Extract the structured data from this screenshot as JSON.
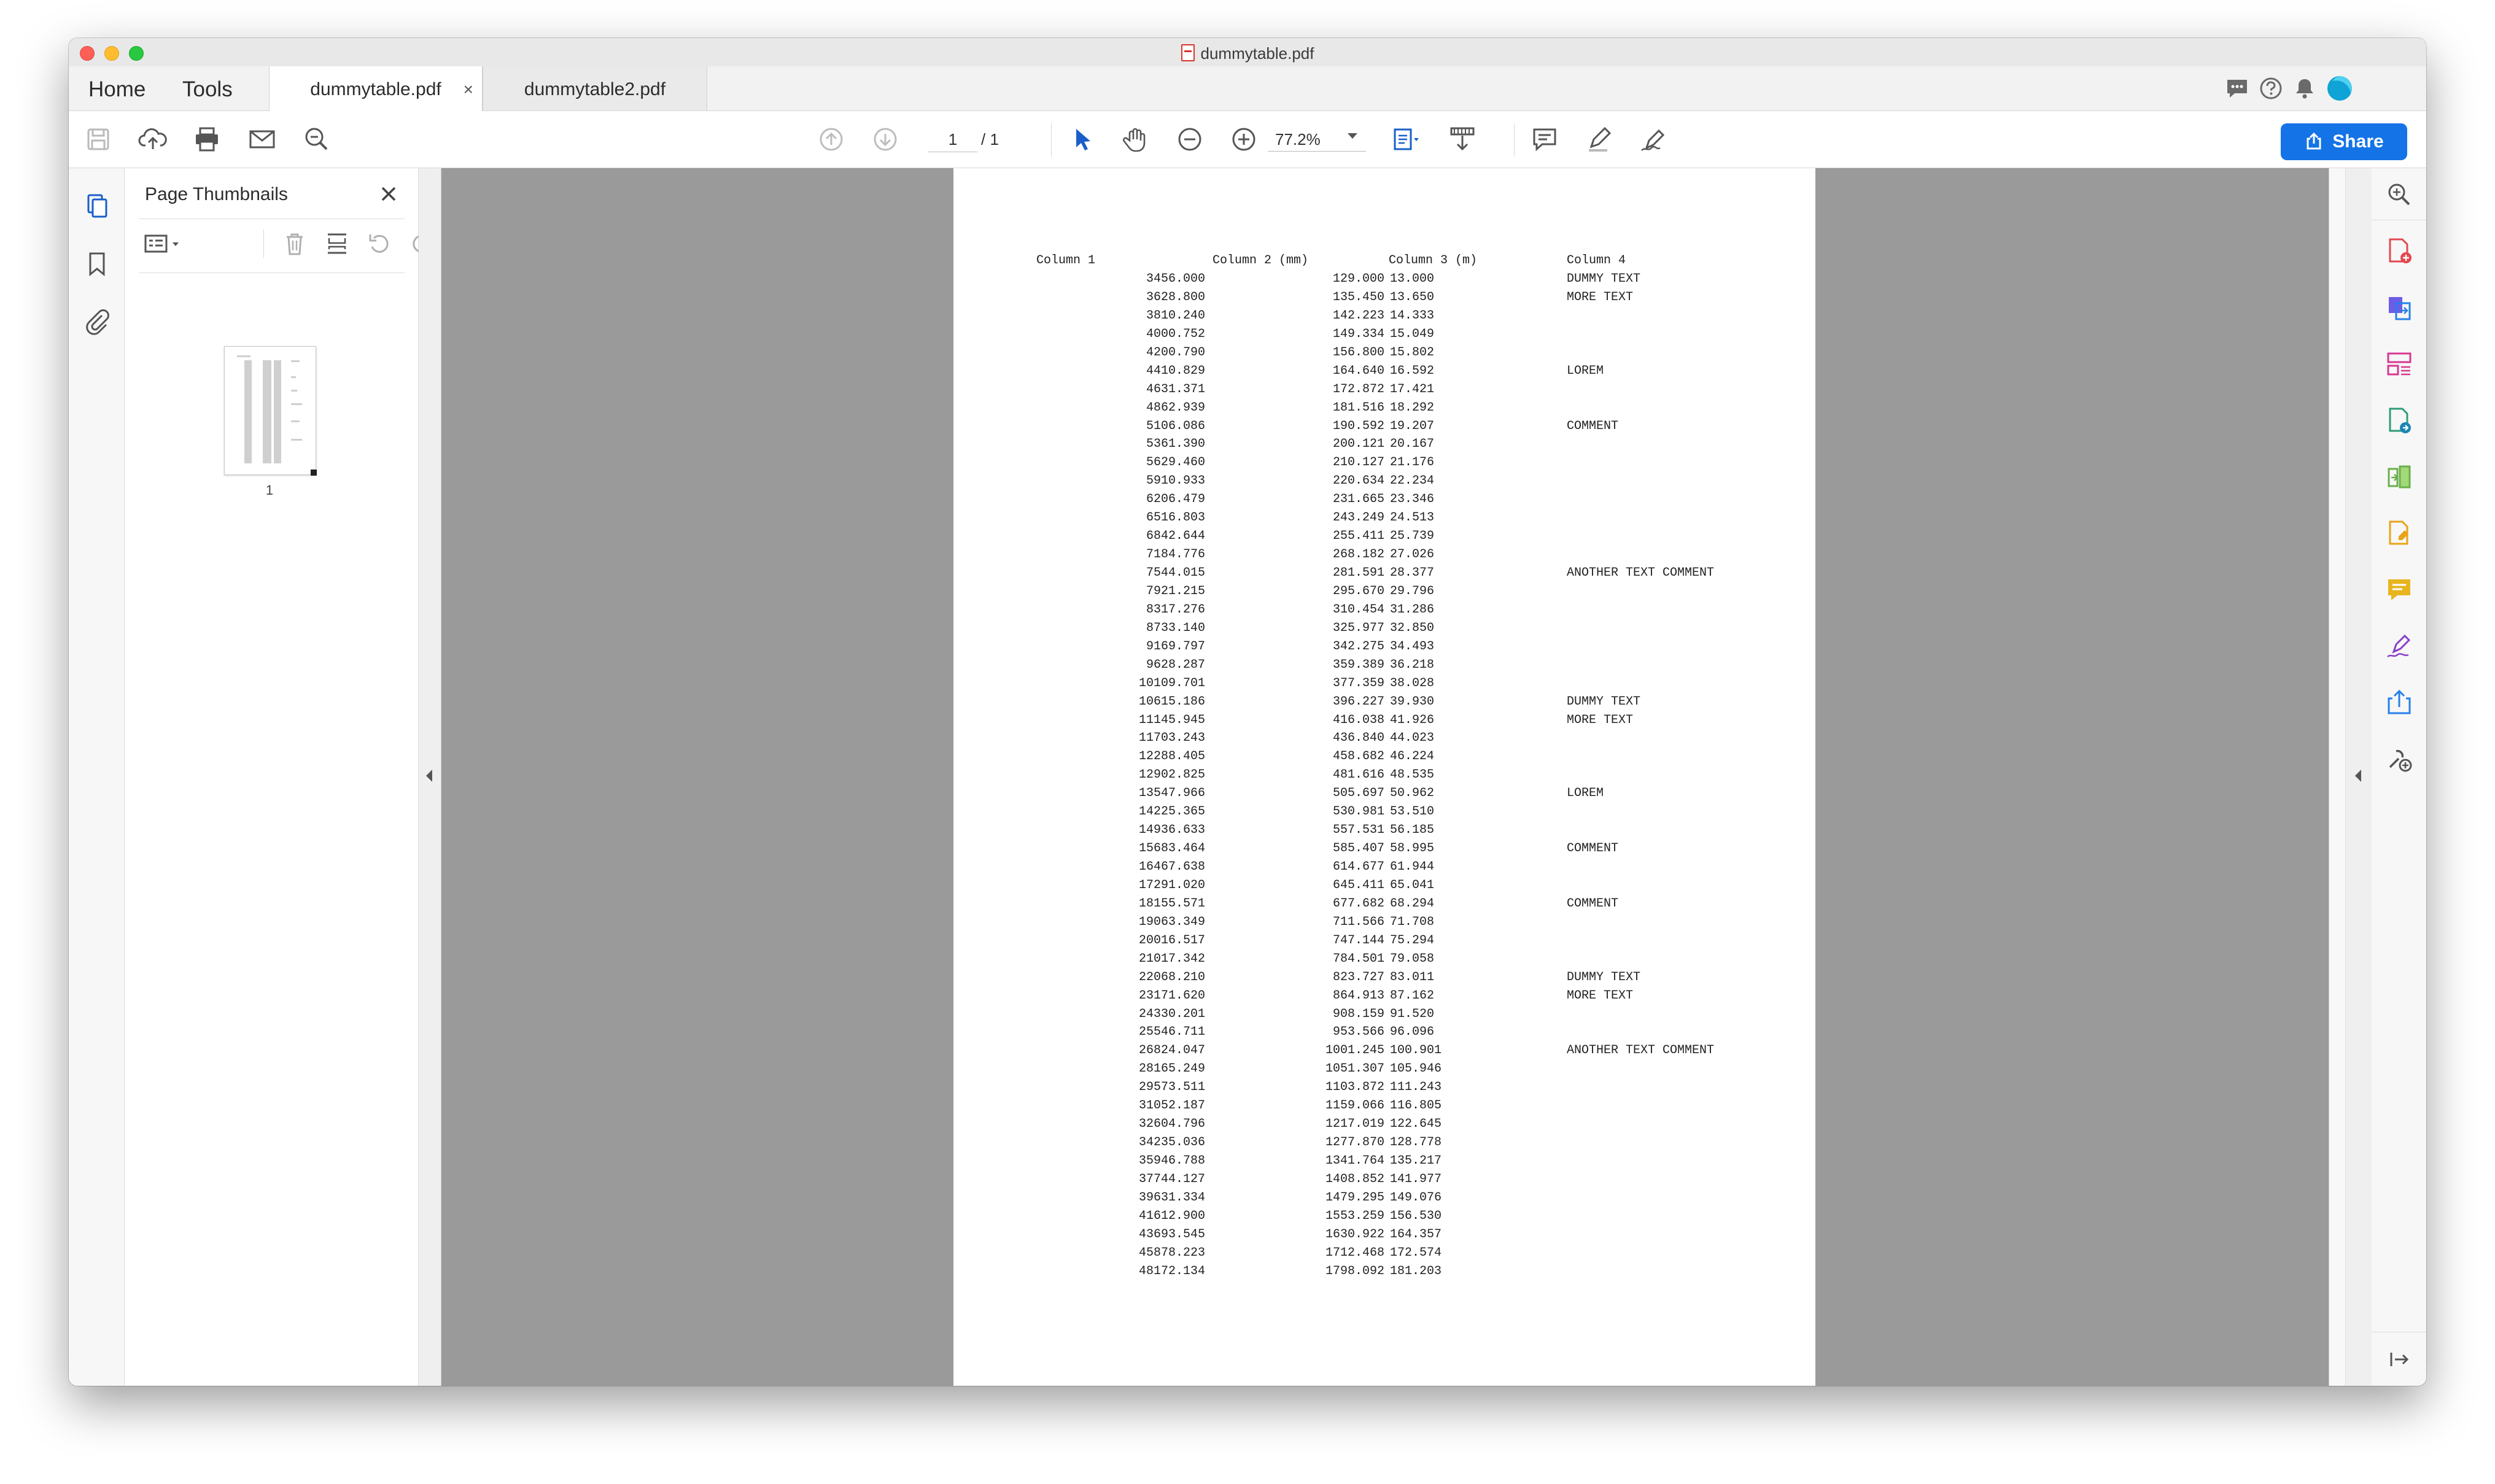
{
  "window": {
    "title": "dummytable.pdf"
  },
  "nav": {
    "home": "Home",
    "tools": "Tools"
  },
  "tabs": [
    {
      "label": "dummytable.pdf",
      "close": "×"
    },
    {
      "label": "dummytable2.pdf"
    }
  ],
  "toolbar": {
    "page_current": "1",
    "page_total": "/ 1",
    "zoom": "77.2%",
    "share_label": "Share"
  },
  "thumbnails": {
    "title": "Page Thumbnails",
    "page_label": "1"
  },
  "colors": {
    "accent": "#1473e6",
    "pdf_red": "#d9342b"
  },
  "document": {
    "headers": [
      "Column 1",
      "Column 2 (mm)",
      "Column 3 (m)",
      "Column 4"
    ],
    "rows": [
      [
        "3456.000",
        "129.000",
        "13.000",
        "DUMMY TEXT"
      ],
      [
        "3628.800",
        "135.450",
        "13.650",
        "MORE TEXT"
      ],
      [
        "3810.240",
        "142.223",
        "14.333",
        ""
      ],
      [
        "4000.752",
        "149.334",
        "15.049",
        ""
      ],
      [
        "4200.790",
        "156.800",
        "15.802",
        ""
      ],
      [
        "4410.829",
        "164.640",
        "16.592",
        "LOREM"
      ],
      [
        "4631.371",
        "172.872",
        "17.421",
        ""
      ],
      [
        "4862.939",
        "181.516",
        "18.292",
        ""
      ],
      [
        "5106.086",
        "190.592",
        "19.207",
        "COMMENT"
      ],
      [
        "5361.390",
        "200.121",
        "20.167",
        ""
      ],
      [
        "5629.460",
        "210.127",
        "21.176",
        ""
      ],
      [
        "5910.933",
        "220.634",
        "22.234",
        ""
      ],
      [
        "6206.479",
        "231.665",
        "23.346",
        ""
      ],
      [
        "6516.803",
        "243.249",
        "24.513",
        ""
      ],
      [
        "6842.644",
        "255.411",
        "25.739",
        ""
      ],
      [
        "7184.776",
        "268.182",
        "27.026",
        ""
      ],
      [
        "7544.015",
        "281.591",
        "28.377",
        "ANOTHER TEXT COMMENT"
      ],
      [
        "7921.215",
        "295.670",
        "29.796",
        ""
      ],
      [
        "8317.276",
        "310.454",
        "31.286",
        ""
      ],
      [
        "8733.140",
        "325.977",
        "32.850",
        ""
      ],
      [
        "9169.797",
        "342.275",
        "34.493",
        ""
      ],
      [
        "9628.287",
        "359.389",
        "36.218",
        ""
      ],
      [
        "10109.701",
        "377.359",
        "38.028",
        ""
      ],
      [
        "10615.186",
        "396.227",
        "39.930",
        "DUMMY TEXT"
      ],
      [
        "11145.945",
        "416.038",
        "41.926",
        "MORE TEXT"
      ],
      [
        "11703.243",
        "436.840",
        "44.023",
        ""
      ],
      [
        "12288.405",
        "458.682",
        "46.224",
        ""
      ],
      [
        "12902.825",
        "481.616",
        "48.535",
        ""
      ],
      [
        "13547.966",
        "505.697",
        "50.962",
        "LOREM"
      ],
      [
        "14225.365",
        "530.981",
        "53.510",
        ""
      ],
      [
        "14936.633",
        "557.531",
        "56.185",
        ""
      ],
      [
        "15683.464",
        "585.407",
        "58.995",
        "COMMENT"
      ],
      [
        "16467.638",
        "614.677",
        "61.944",
        ""
      ],
      [
        "17291.020",
        "645.411",
        "65.041",
        ""
      ],
      [
        "18155.571",
        "677.682",
        "68.294",
        "COMMENT"
      ],
      [
        "19063.349",
        "711.566",
        "71.708",
        ""
      ],
      [
        "20016.517",
        "747.144",
        "75.294",
        ""
      ],
      [
        "21017.342",
        "784.501",
        "79.058",
        ""
      ],
      [
        "22068.210",
        "823.727",
        "83.011",
        "DUMMY TEXT"
      ],
      [
        "23171.620",
        "864.913",
        "87.162",
        "MORE TEXT"
      ],
      [
        "24330.201",
        "908.159",
        "91.520",
        ""
      ],
      [
        "25546.711",
        "953.566",
        "96.096",
        ""
      ],
      [
        "26824.047",
        "1001.245",
        "100.901",
        "ANOTHER TEXT COMMENT"
      ],
      [
        "28165.249",
        "1051.307",
        "105.946",
        ""
      ],
      [
        "29573.511",
        "1103.872",
        "111.243",
        ""
      ],
      [
        "31052.187",
        "1159.066",
        "116.805",
        ""
      ],
      [
        "32604.796",
        "1217.019",
        "122.645",
        ""
      ],
      [
        "34235.036",
        "1277.870",
        "128.778",
        ""
      ],
      [
        "35946.788",
        "1341.764",
        "135.217",
        ""
      ],
      [
        "37744.127",
        "1408.852",
        "141.977",
        ""
      ],
      [
        "39631.334",
        "1479.295",
        "149.076",
        ""
      ],
      [
        "41612.900",
        "1553.259",
        "156.530",
        ""
      ],
      [
        "43693.545",
        "1630.922",
        "164.357",
        ""
      ],
      [
        "45878.223",
        "1712.468",
        "172.574",
        ""
      ],
      [
        "48172.134",
        "1798.092",
        "181.203",
        ""
      ]
    ]
  }
}
